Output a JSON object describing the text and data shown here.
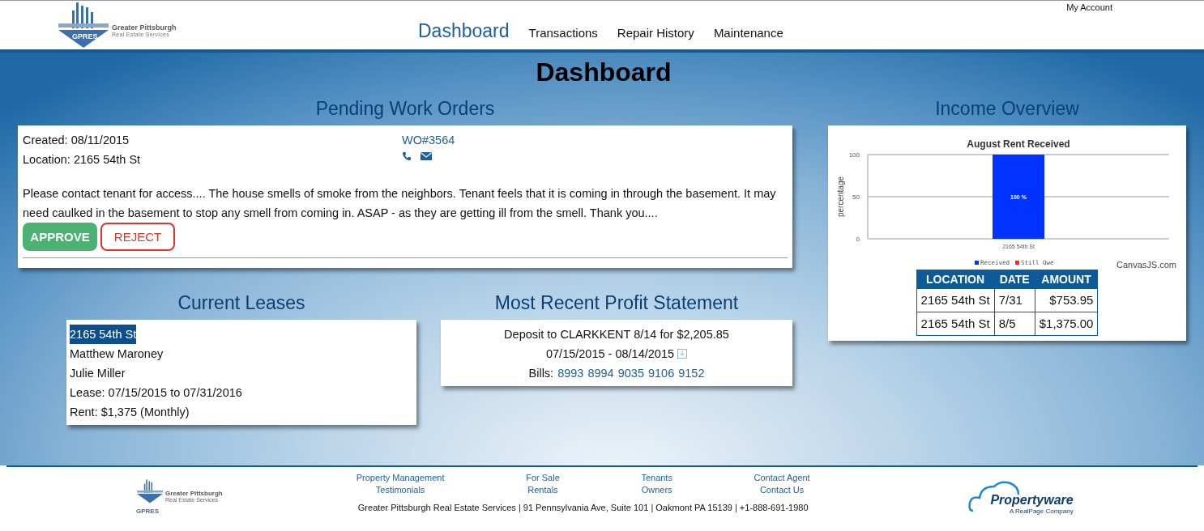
{
  "header": {
    "logo": {
      "mark": "GPRES",
      "name": "Greater Pittsburgh",
      "tagline": "Real Estate Services"
    },
    "account_link": "My Account",
    "nav": [
      {
        "label": "Dashboard",
        "selected": true
      },
      {
        "label": "Transactions",
        "selected": false
      },
      {
        "label": "Repair History",
        "selected": false
      },
      {
        "label": "Maintenance",
        "selected": false
      }
    ]
  },
  "page_title": "Dashboard",
  "pending_work_orders": {
    "heading": "Pending Work Orders",
    "created": "Created: 08/11/2015",
    "location": "Location: 2165 54th St",
    "work_order": "WO#3564",
    "description": "Please contact tenant for access.... The house smells of smoke from the neighbors. Tenant feels that it is coming in through the basement. It may need caulked in the basement to stop any smell from coming in. ASAP - as they are getting ill from the smell. Thank you....",
    "buttons": [
      {
        "label": "APPROVE",
        "kind": "approve"
      },
      {
        "label": "REJECT",
        "kind": "reject"
      }
    ]
  },
  "current_leases": {
    "heading": "Current Leases",
    "address": {
      "text": "2165 54th St",
      "selected": true
    },
    "lines": [
      "Matthew Maroney",
      "Julie Miller",
      "Lease: 07/15/2015 to 07/31/2016",
      "Rent: $1,375 (Monthly)"
    ]
  },
  "profit_statement": {
    "heading": "Most Recent Profit Statement",
    "deposit": "Deposit to CLARKKENT 8/14 for $2,205.85",
    "period": "07/15/2015 - 08/14/2015",
    "bills_label": "Bills:",
    "bills": [
      "8993",
      "8994",
      "9035",
      "9106",
      "9152"
    ]
  },
  "income_overview": {
    "heading": "Income Overview",
    "chart_data": {
      "type": "bar",
      "title": "August Rent Received",
      "ylabel": "percentage",
      "categories": [
        "2165 54th St"
      ],
      "series": [
        {
          "name": "Received",
          "color": "#0033ff",
          "values": [
            100
          ]
        },
        {
          "name": "Still Owe",
          "color": "#ff2a1a",
          "values": [
            0
          ]
        }
      ],
      "ylim": [
        0,
        100
      ],
      "yticks": [
        0,
        50,
        100
      ],
      "value_labels": [
        "100 %"
      ]
    },
    "credit": "CanvasJS.com",
    "table": {
      "columns": [
        "LOCATION",
        "DATE",
        "AMOUNT"
      ],
      "rows": [
        [
          "2165 54th St",
          "7/31",
          "$753.95"
        ],
        [
          "2165 54th St",
          "8/5",
          "$1,375.00"
        ]
      ]
    }
  },
  "footer": {
    "logo": {
      "mark": "GPRES",
      "name": "Greater Pittsburgh",
      "tagline": "Real Estate Services"
    },
    "link_columns": [
      [
        "Property Management",
        "Testimonials"
      ],
      [
        "For Sale",
        "Rentals"
      ],
      [
        "Tenants",
        "Owners"
      ],
      [
        "Contact Agent",
        "Contact Us"
      ]
    ],
    "address": "Greater Pittsburgh Real Estate Services | 91 Pennsylvania Ave, Suite 101 | Oakmont PA 15139 | +1-888-691-1980",
    "partner_logo": {
      "name": "Propertyware",
      "tagline": "A RealPage Company"
    }
  }
}
